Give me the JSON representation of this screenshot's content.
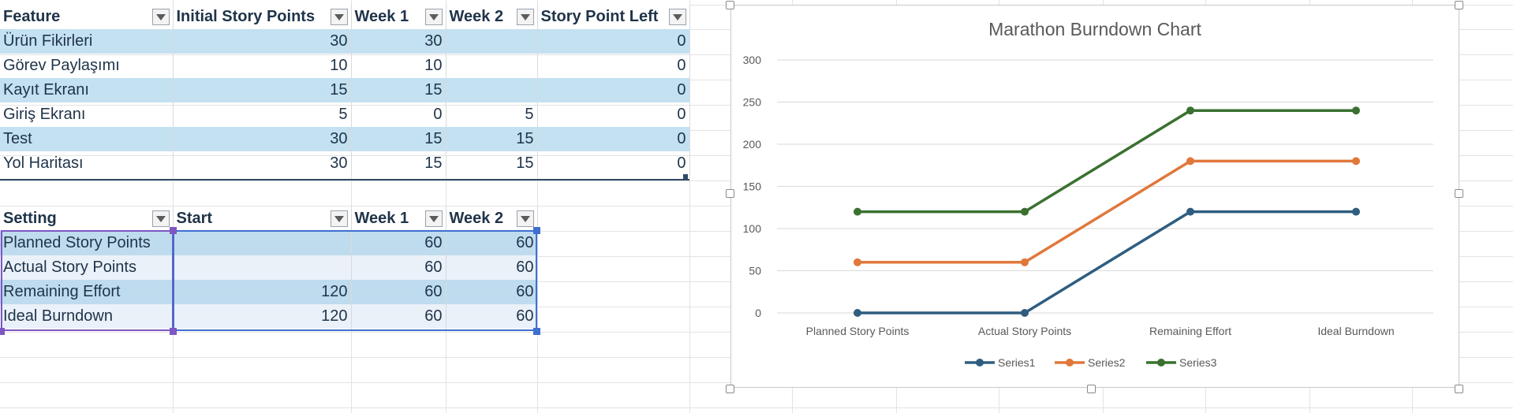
{
  "table1": {
    "headers": [
      "Feature",
      "Initial Story Points",
      "Week 1",
      "Week 2",
      "Story Point Left"
    ],
    "rows": [
      [
        "Ürün Fikirleri",
        "30",
        "30",
        "",
        "0"
      ],
      [
        "Görev Paylaşımı",
        "10",
        "10",
        "",
        "0"
      ],
      [
        "Kayıt Ekranı",
        "15",
        "15",
        "",
        "0"
      ],
      [
        "Giriş Ekranı",
        "5",
        "0",
        "5",
        "0"
      ],
      [
        "Test",
        "30",
        "15",
        "15",
        "0"
      ],
      [
        "Yol Haritası",
        "30",
        "15",
        "15",
        "0"
      ]
    ]
  },
  "table2": {
    "headers": [
      "Setting",
      "Start",
      "Week 1",
      "Week 2"
    ],
    "rows": [
      [
        "Planned Story Points",
        "",
        "60",
        "60"
      ],
      [
        "Actual Story Points",
        "",
        "60",
        "60"
      ],
      [
        "Remaining Effort",
        "120",
        "60",
        "60"
      ],
      [
        "Ideal Burndown",
        "120",
        "60",
        "60"
      ]
    ]
  },
  "colors": {
    "table_band": "#c3e1f0",
    "series1": "#2e5d80",
    "series2": "#e0783c",
    "series3": "#3a7030",
    "selection_purple": "#7e57c2",
    "selection_blue": "#3f6fd0"
  },
  "chart_data": {
    "type": "line",
    "title": "Marathon Burndown Chart",
    "categories": [
      "Planned Story Points",
      "Actual Story Points",
      "Remaining Effort",
      "Ideal Burndown"
    ],
    "series": [
      {
        "name": "Series1",
        "values": [
          0,
          0,
          120,
          120
        ]
      },
      {
        "name": "Series2",
        "values": [
          60,
          60,
          180,
          180
        ]
      },
      {
        "name": "Series3",
        "values": [
          120,
          120,
          240,
          240
        ]
      }
    ],
    "yticks": [
      "0",
      "50",
      "100",
      "150",
      "200",
      "250",
      "300"
    ],
    "ylim": [
      0,
      300
    ],
    "grid": true,
    "legend_position": "bottom",
    "stacked": true
  }
}
